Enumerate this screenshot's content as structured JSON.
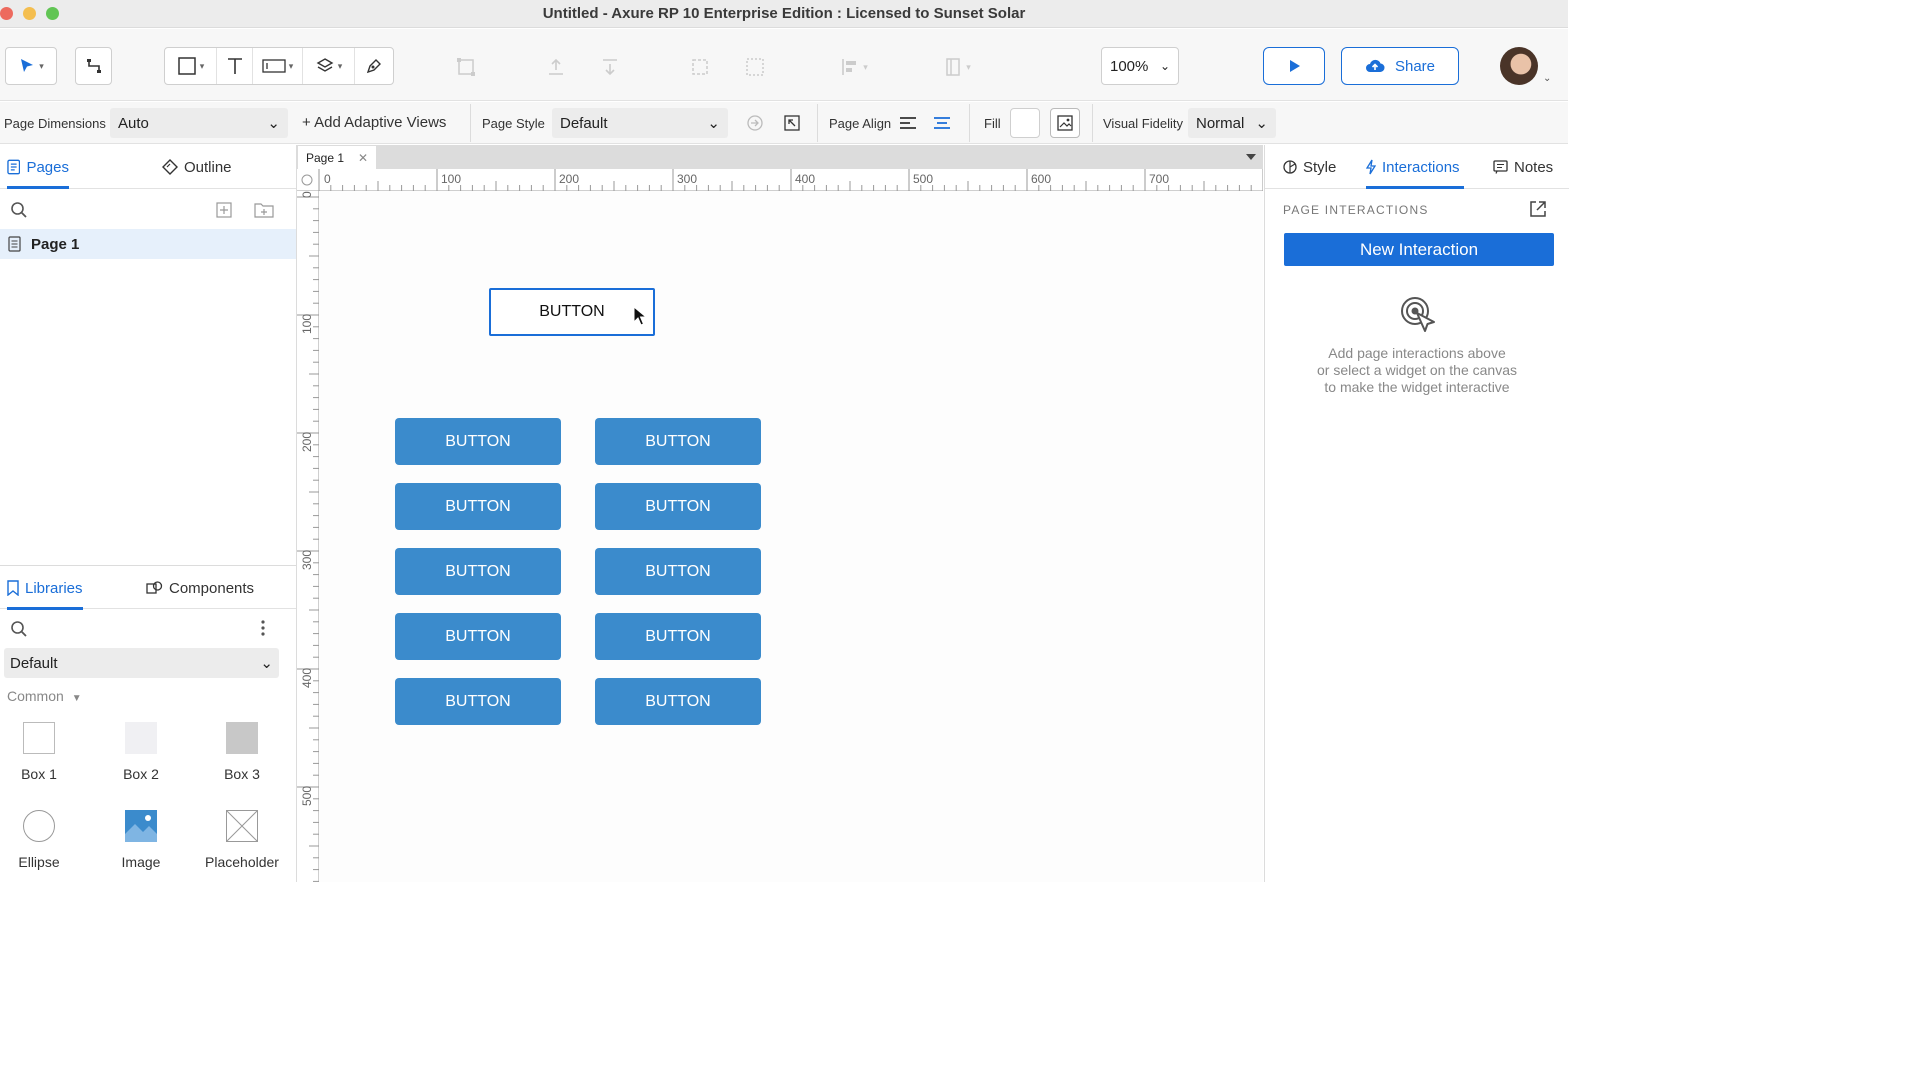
{
  "window": {
    "title": "Untitled - Axure RP 10 Enterprise Edition : Licensed to Sunset Solar"
  },
  "toolbar": {
    "zoom": "100%",
    "share_label": "Share",
    "icons": [
      "select-pointer-icon",
      "connector-icon",
      "rectangle-icon",
      "text-icon",
      "input-icon",
      "layers-icon",
      "pen-icon",
      "group-icon",
      "bring-front-icon",
      "send-back-icon",
      "ungroup-icon",
      "distribute-icon",
      "align-icon",
      "more-icon",
      "preview-play-icon",
      "cloud-upload-icon"
    ]
  },
  "properties_bar": {
    "page_dimensions_label": "Page Dimensions",
    "page_dimensions_value": "Auto",
    "add_adaptive_views": "+ Add Adaptive Views",
    "page_style_label": "Page Style",
    "page_style_value": "Default",
    "page_align_label": "Page Align",
    "fill_label": "Fill",
    "visual_fidelity_label": "Visual Fidelity",
    "visual_fidelity_value": "Normal"
  },
  "left_panel": {
    "tabs": [
      {
        "label": "Pages",
        "active": true
      },
      {
        "label": "Outline",
        "active": false
      }
    ],
    "pages": [
      {
        "label": "Page 1",
        "selected": true
      }
    ],
    "library_tabs": [
      {
        "label": "Libraries",
        "active": true
      },
      {
        "label": "Components",
        "active": false
      }
    ],
    "library_select": "Default",
    "category": "Common",
    "widgets": [
      {
        "label": "Box 1",
        "icon": "box1-icon"
      },
      {
        "label": "Box 2",
        "icon": "box2-icon"
      },
      {
        "label": "Box 3",
        "icon": "box3-icon"
      },
      {
        "label": "Ellipse",
        "icon": "ellipse-icon"
      },
      {
        "label": "Image",
        "icon": "image-icon"
      },
      {
        "label": "Placeholder",
        "icon": "placeholder-icon"
      }
    ]
  },
  "canvas": {
    "doc_tab": "Page 1",
    "ruler_h": [
      "0",
      "100",
      "200",
      "300",
      "400",
      "500",
      "600",
      "700"
    ],
    "ruler_v": [
      "0",
      "100",
      "200",
      "300",
      "400",
      "500"
    ],
    "selected_button": "BUTTON",
    "buttons": [
      "BUTTON",
      "BUTTON",
      "BUTTON",
      "BUTTON",
      "BUTTON",
      "BUTTON",
      "BUTTON",
      "BUTTON",
      "BUTTON",
      "BUTTON"
    ],
    "colors": {
      "button_fill": "#3b8bcc",
      "selection": "#1a6ed8"
    }
  },
  "right_panel": {
    "tabs": [
      {
        "label": "Style",
        "active": false
      },
      {
        "label": "Interactions",
        "active": true
      },
      {
        "label": "Notes",
        "active": false
      }
    ],
    "section_title": "PAGE INTERACTIONS",
    "new_interaction": "New Interaction",
    "hint": [
      "Add page interactions above",
      "or select a widget on the canvas",
      "to make the widget interactive"
    ]
  },
  "accent": "#1a6ed8"
}
